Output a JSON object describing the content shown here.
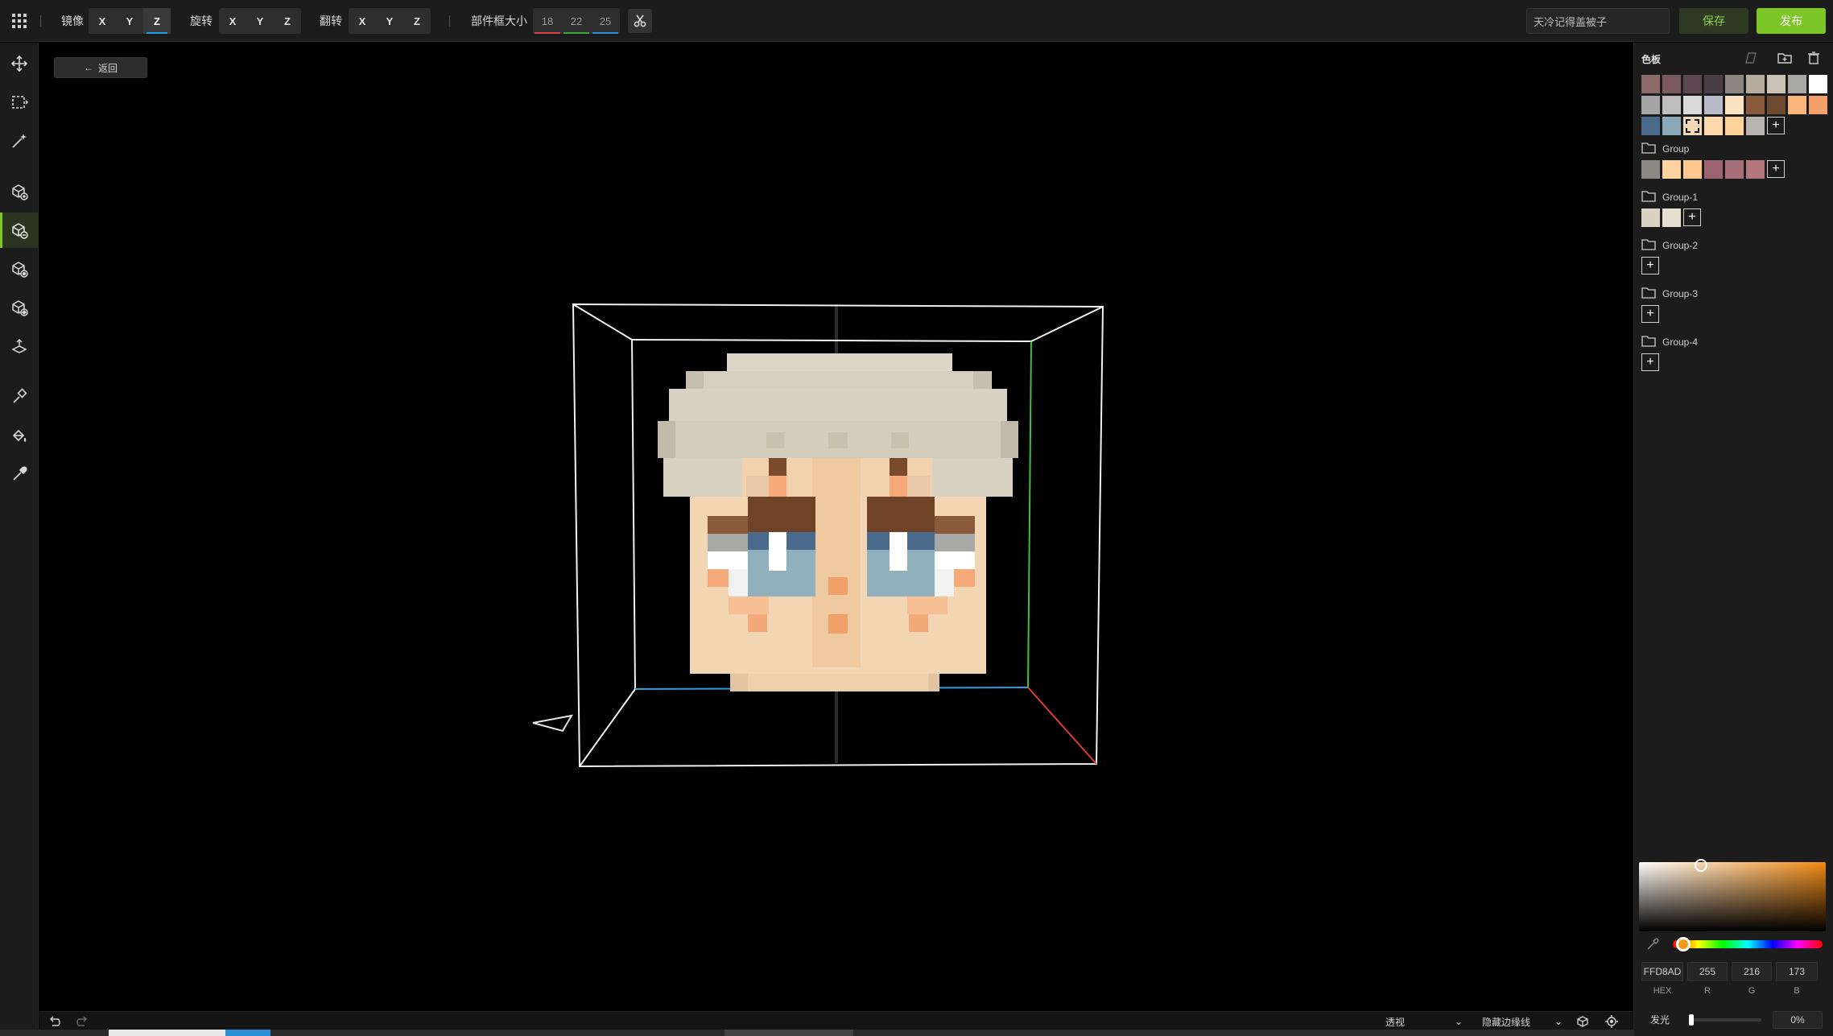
{
  "toolbar": {
    "mirror_label": "镜像",
    "rotate_label": "旋转",
    "flip_label": "翻转",
    "axes": [
      "X",
      "Y",
      "Z"
    ],
    "mirror_active_axis": "Z",
    "size_label": "部件框大小",
    "size_values": [
      "18",
      "22",
      "25"
    ],
    "name_value": "天冷记得盖被子",
    "save_label": "保存",
    "publish_label": "发布"
  },
  "left_tools": [
    "move-tool",
    "select-box-tool",
    "magic-wand-tool",
    "add-voxel-tool",
    "erase-voxel-tool",
    "paint-voxel-tool",
    "fill-voxel-tool",
    "extrude-tool",
    "brush-tool",
    "bucket-fill-tool",
    "eyedropper-tool"
  ],
  "viewport": {
    "back_label": "返回"
  },
  "bottom": {
    "projection_label": "透视",
    "edge_label": "隐藏边缘线"
  },
  "palette": {
    "title": "色板",
    "main_swatches": [
      "#8c6a6a",
      "#7a5a5c",
      "#5c4750",
      "#4a3e48",
      "#8c8680",
      "#b7aca0",
      "#c9c3b8",
      "#a8a8a6",
      "#ffffff",
      "#a6a6a6",
      "#bdbdbd",
      "#d9d9d9",
      "#b8b9c9",
      "#fde2c4",
      "#8a5a3c",
      "#6e4a30",
      "#f9b57c",
      "#f5a06a",
      "#4a6a8c",
      "#8aaab8",
      "#f4d9b8",
      "#ffd8ad",
      "#ffd29c",
      "#b8b4b0"
    ],
    "selected_index": 20,
    "groups": [
      {
        "name": "Group",
        "swatches": [
          "#8e8883",
          "#ffd3a0",
          "#ffc890",
          "#9c6370",
          "#a66e78",
          "#b3767c"
        ]
      },
      {
        "name": "Group-1",
        "swatches": [
          "#d9d2c3",
          "#e6dfd0"
        ]
      },
      {
        "name": "Group-2",
        "swatches": []
      },
      {
        "name": "Group-3",
        "swatches": []
      },
      {
        "name": "Group-4",
        "swatches": []
      }
    ]
  },
  "color": {
    "hex": "FFD8AD",
    "r": "255",
    "g": "216",
    "b": "173",
    "hex_label": "HEX",
    "r_label": "R",
    "g_label": "G",
    "b_label": "B",
    "glow_label": "发光",
    "glow_value": "0%",
    "glow_level": 0
  },
  "colors": {
    "accent_green": "#7cc627",
    "axis_x": "#d94040",
    "axis_y": "#3ca63c",
    "axis_z": "#2a8fd6"
  }
}
